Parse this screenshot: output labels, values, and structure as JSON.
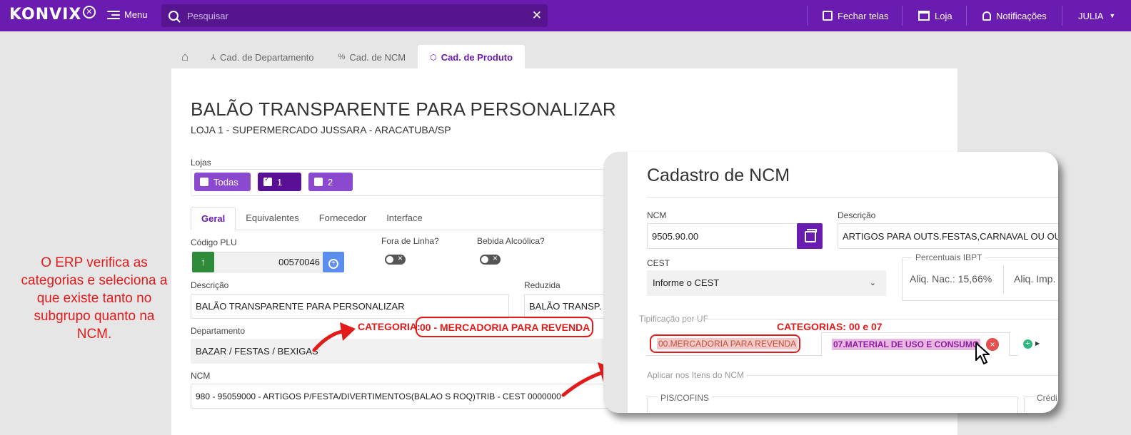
{
  "topbar": {
    "logo_text": "KONVIX",
    "menu_label": "Menu",
    "search_placeholder": "Pesquisar",
    "close_tabs_label": "Fechar telas",
    "store_label": "Loja",
    "notifications_label": "Notificações",
    "user_label": "JULIA"
  },
  "tabs": [
    {
      "label": "Cad. de Departamento"
    },
    {
      "label": "Cad. de NCM"
    },
    {
      "label": "Cad. de Produto"
    }
  ],
  "product": {
    "title": "BALÃO TRANSPARENTE PARA PERSONALIZAR",
    "store_line": "LOJA 1 - SUPERMERCADO JUSSARA - ARACATUBA/SP",
    "lojas_label": "Lojas",
    "store_chips": [
      {
        "label": "Todas",
        "checked": false
      },
      {
        "label": "1",
        "checked": true
      },
      {
        "label": "2",
        "checked": false
      }
    ],
    "subtabs": [
      "Geral",
      "Equivalentes",
      "Fornecedor",
      "Interface"
    ],
    "plu_label": "Código PLU",
    "plu_value": "00570046",
    "fora_linha_label": "Fora de Linha?",
    "bebida_label": "Bebida Alcoólica?",
    "descricao_label": "Descrição",
    "descricao_value": "BALÃO TRANSPARENTE PARA PERSONALIZAR",
    "reduzida_label": "Reduzida",
    "reduzida_value": "BALÃO TRANSP. P/",
    "departamento_label": "Departamento",
    "departamento_value": "BAZAR / FESTAS / BEXIGAS",
    "ncm_label": "NCM",
    "ncm_value": "980 - 95059000 - ARTIGOS P/FESTA/DIVERTIMENTOS(BALAO S ROQ)TRIB - CEST 0000000"
  },
  "annotations": {
    "left_note": "O ERP verifica as categorias e seleciona a que existe tanto no subgrupo quanto na NCM.",
    "categoria_prefix": "CATEGORIA:",
    "categoria_value": "00 - MERCADORIA PARA REVENDA",
    "categorias_popup": "CATEGORIAS: 00  e 07"
  },
  "ncm_popup": {
    "title": "Cadastro de NCM",
    "ncm_label": "NCM",
    "ncm_value": "9505.90.00",
    "descricao_label": "Descrição",
    "descricao_value": "ARTIGOS PARA OUTS.FESTAS,CARNAVAL OU OUTS. DIV",
    "cest_label": "CEST",
    "cest_value": "Informe o CEST",
    "ibpt_legend": "Percentuais IBPT",
    "aliq_nac": "Aliq. Nac.: 15,66%",
    "aliq_imp": "Aliq. Imp.",
    "tipificacao_label": "Tipificação por UF",
    "cat1": "00.MERCADORIA PARA REVENDA",
    "cat2": "07.MATERIAL DE USO E CONSUMO",
    "aplicar_label": "Aplicar nos Itens do NCM",
    "pis_label": "PIS/COFINS",
    "credito_label": "Crédi"
  },
  "colors": {
    "brand_purple": "#6a1bb0",
    "annotation_red": "#e31b1b",
    "green_button": "#2e8b3a",
    "blue_button": "#5b8def"
  }
}
